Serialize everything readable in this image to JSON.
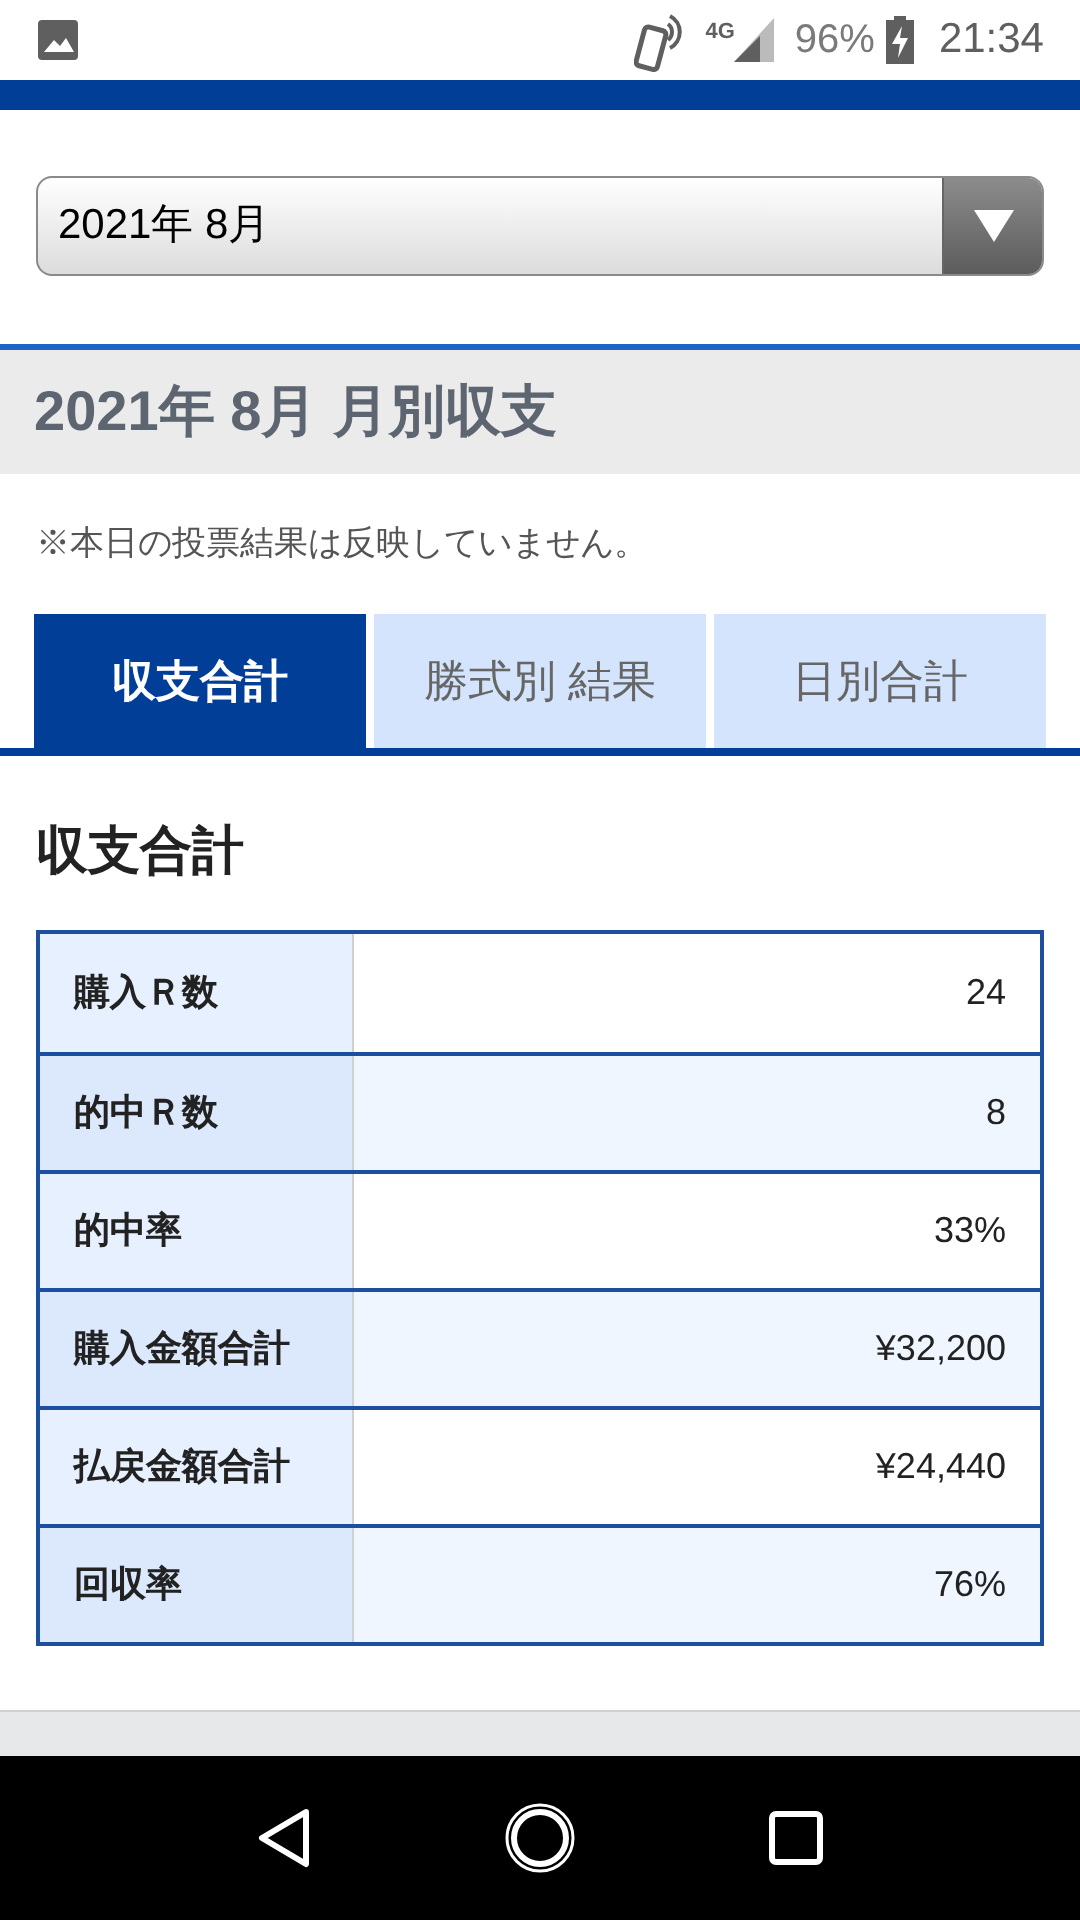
{
  "status_bar": {
    "battery": "96%",
    "time": "21:34",
    "network": "4G"
  },
  "month_select": {
    "value": "2021年 8月"
  },
  "section_title": "2021年 8月 月別収支",
  "note": "※本日の投票結果は反映していません。",
  "tabs": [
    {
      "label": "収支合計",
      "selected": true
    },
    {
      "label": "勝式別 結果",
      "selected": false
    },
    {
      "label": "日別合計",
      "selected": false
    }
  ],
  "summary": {
    "heading": "収支合計",
    "rows": [
      {
        "label": "購入Ｒ数",
        "value": "24"
      },
      {
        "label": "的中Ｒ数",
        "value": "8"
      },
      {
        "label": "的中率",
        "value": "33%"
      },
      {
        "label": "購入金額合計",
        "value": "¥32,200"
      },
      {
        "label": "払戻金額合計",
        "value": "¥24,440"
      },
      {
        "label": "回収率",
        "value": "76%"
      }
    ]
  }
}
